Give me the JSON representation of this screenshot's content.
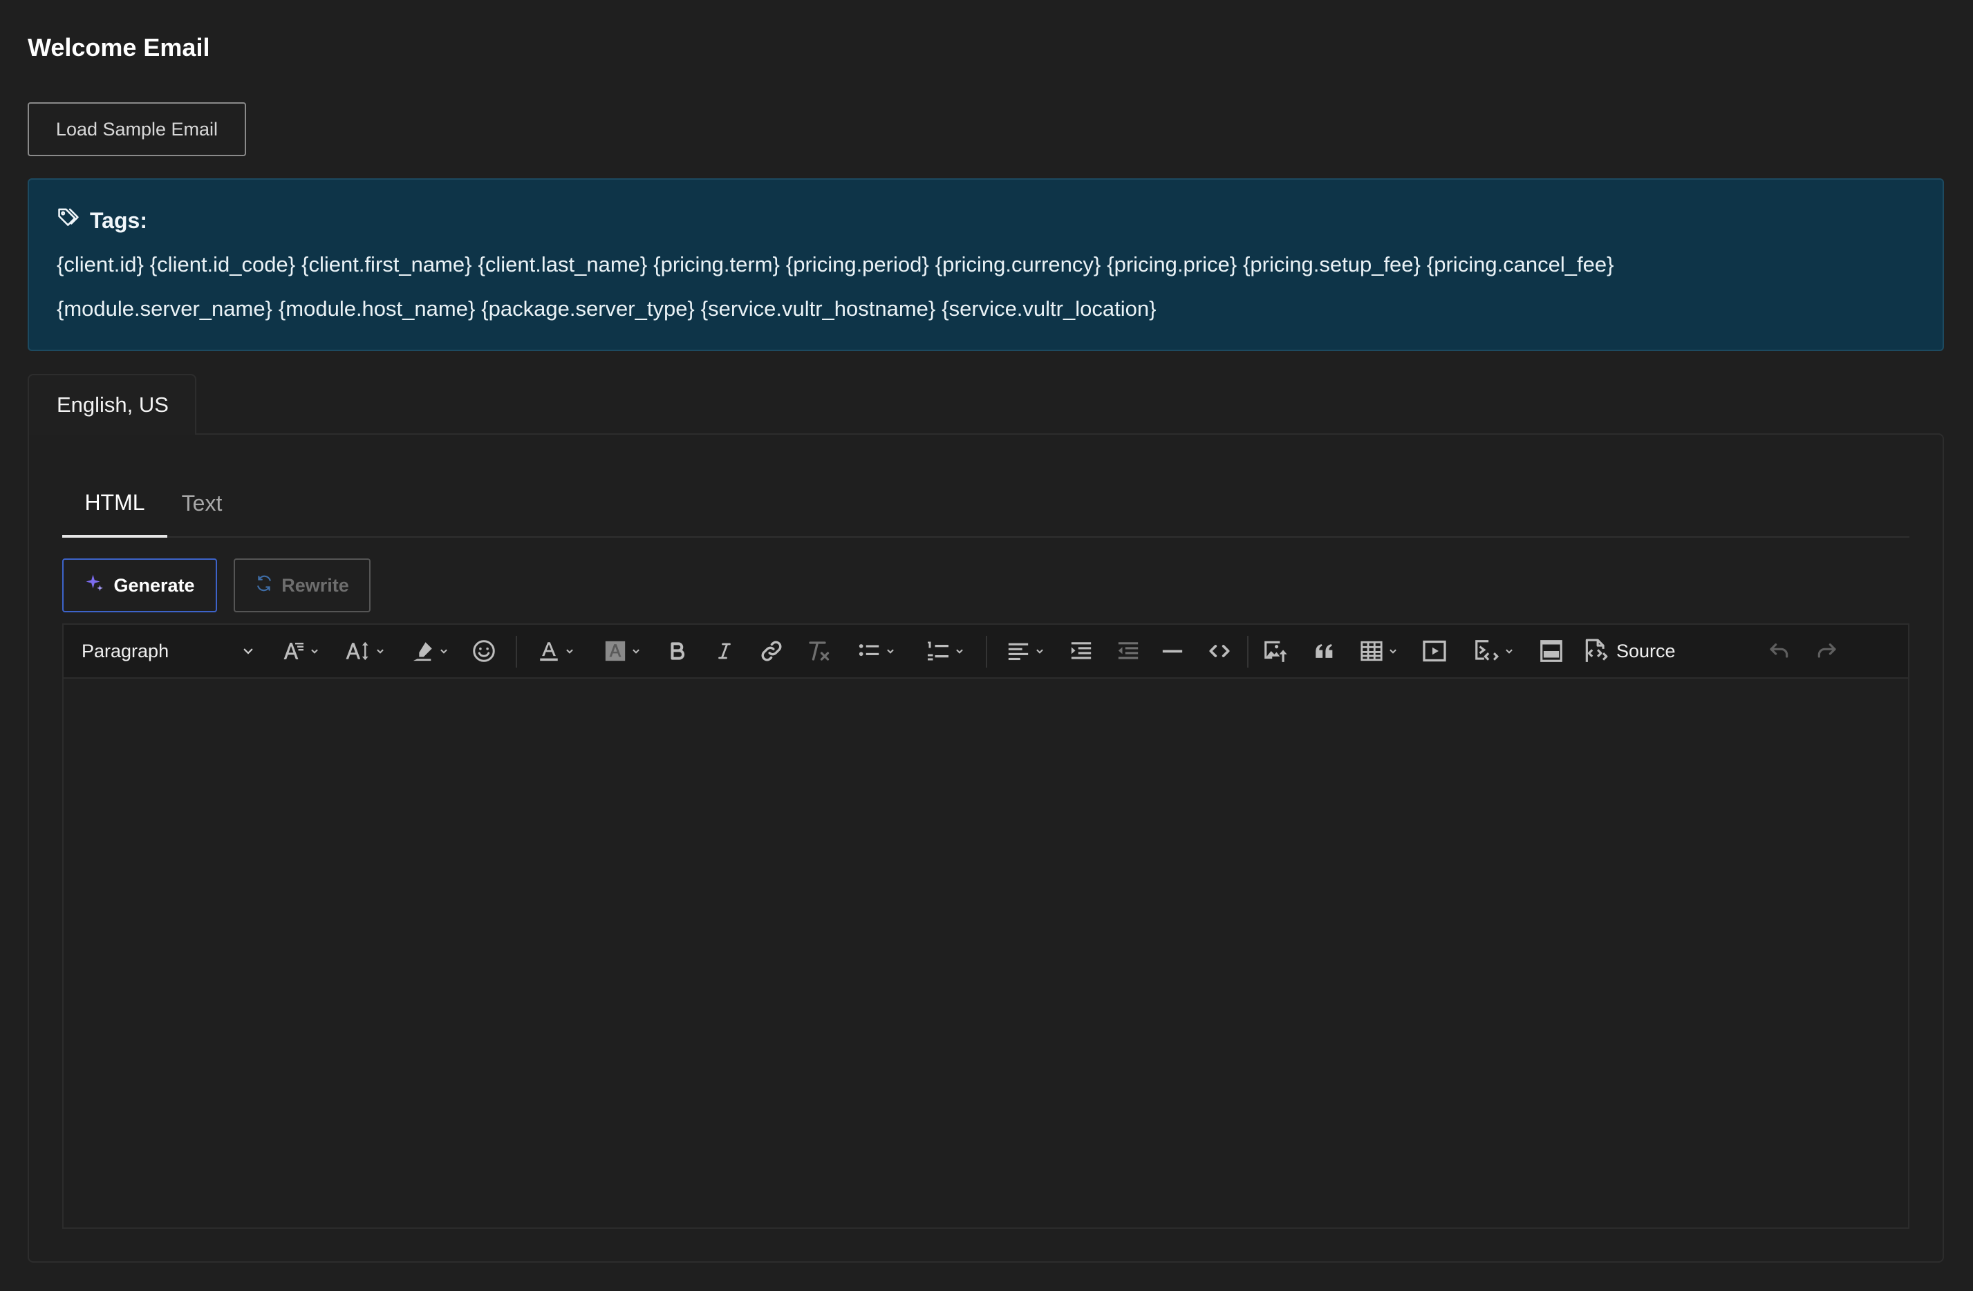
{
  "page": {
    "title": "Welcome Email"
  },
  "actions": {
    "load_sample": "Load Sample Email"
  },
  "tags": {
    "heading": "Tags:",
    "line1": [
      "{client.id}",
      "{client.id_code}",
      "{client.first_name}",
      "{client.last_name}",
      "{pricing.term}",
      "{pricing.period}",
      "{pricing.currency}",
      "{pricing.price}",
      "{pricing.setup_fee}",
      "{pricing.cancel_fee}"
    ],
    "line2": [
      "{module.server_name}",
      "{module.host_name}",
      "{package.server_type}",
      "{service.vultr_hostname}",
      "{service.vultr_location}"
    ]
  },
  "language_tab": {
    "label": "English, US"
  },
  "format_tabs": [
    {
      "label": "HTML",
      "active": true
    },
    {
      "label": "Text",
      "active": false
    }
  ],
  "ai": {
    "generate": "Generate",
    "rewrite": "Rewrite",
    "rewrite_disabled": true
  },
  "editor": {
    "block_format": "Paragraph",
    "source_label": "Source",
    "content": "",
    "toolbar_icons": [
      "font-family-icon",
      "font-size-icon",
      "highlight-icon",
      "emoji-icon",
      "font-color-icon",
      "background-color-icon",
      "bold-icon",
      "italic-icon",
      "link-icon",
      "remove-format-icon",
      "bulleted-list-icon",
      "numbered-list-icon",
      "align-icon",
      "indent-icon",
      "outdent-icon",
      "horizontal-line-icon",
      "code-icon",
      "insert-image-icon",
      "blockquote-icon",
      "table-icon",
      "media-icon",
      "html-embed-icon",
      "special-block-icon",
      "source-icon",
      "undo-icon",
      "redo-icon"
    ]
  },
  "colors": {
    "background": "#1f1f1f",
    "tags_panel": "#0e3448",
    "generate_border": "#3d63c9",
    "sparkle": "#7c6cf0"
  }
}
